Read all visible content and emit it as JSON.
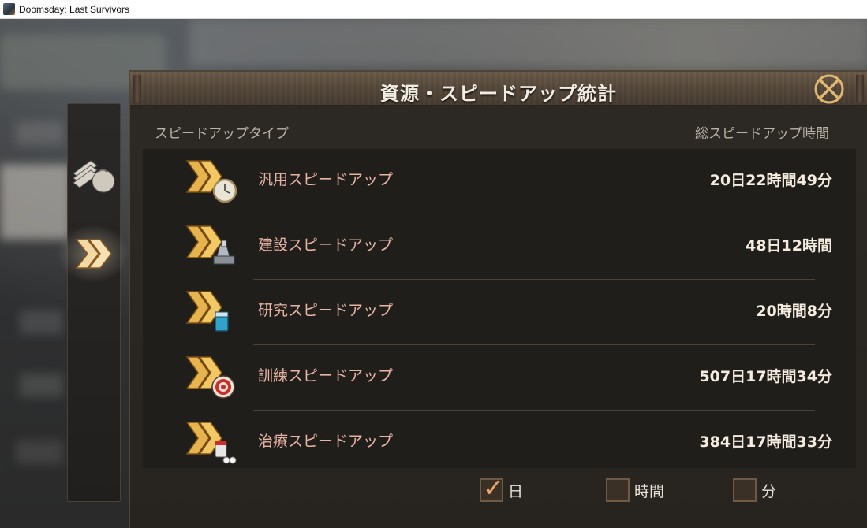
{
  "window": {
    "title": "Doomsday: Last Survivors"
  },
  "panel": {
    "title": "資源・スピードアップ統計",
    "col_type": "スピードアップタイプ",
    "col_total": "総スピードアップ時間"
  },
  "rows": [
    {
      "label": "汎用スピードアップ",
      "value": "20日22時間49分",
      "icon": "general-speedup-icon"
    },
    {
      "label": "建設スピードアップ",
      "value": "48日12時間",
      "icon": "construction-speedup-icon"
    },
    {
      "label": "研究スピードアップ",
      "value": "20時間8分",
      "icon": "research-speedup-icon"
    },
    {
      "label": "訓練スピードアップ",
      "value": "507日17時間34分",
      "icon": "training-speedup-icon"
    },
    {
      "label": "治療スピードアップ",
      "value": "384日17時間33分",
      "icon": "healing-speedup-icon"
    }
  ],
  "units": [
    {
      "label": "日",
      "checked": true
    },
    {
      "label": "時間",
      "checked": false
    },
    {
      "label": "分",
      "checked": false
    }
  ],
  "side_tabs": [
    {
      "icon": "resources-icon",
      "active": false
    },
    {
      "icon": "speedup-icon",
      "active": true
    }
  ],
  "colors": {
    "label": "#e8b4a4",
    "value": "#f5ecdf",
    "gold": "#e7b34e",
    "checkmark": "#f2a56a"
  }
}
